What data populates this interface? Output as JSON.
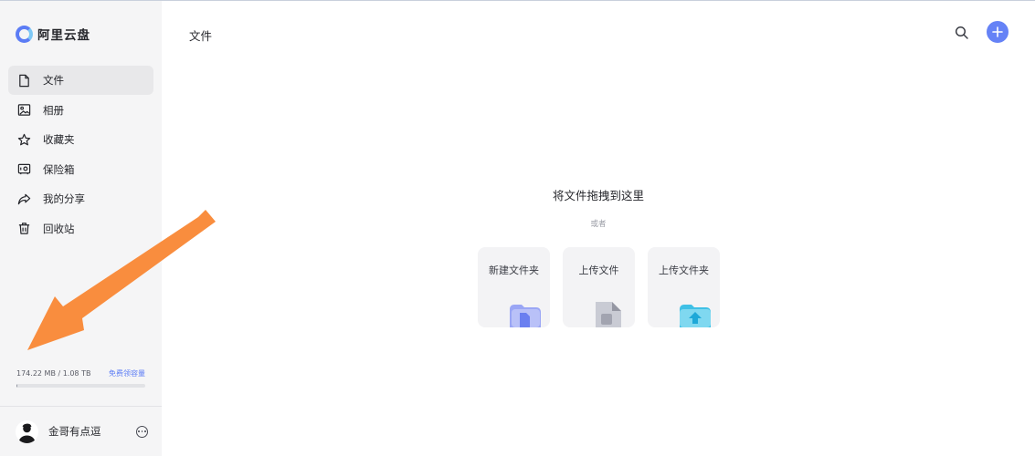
{
  "app": {
    "name": "阿里云盘"
  },
  "sidebar": {
    "items": [
      {
        "label": "文件",
        "icon": "file-icon",
        "active": true
      },
      {
        "label": "相册",
        "icon": "photo-icon",
        "active": false
      },
      {
        "label": "收藏夹",
        "icon": "star-icon",
        "active": false
      },
      {
        "label": "保险箱",
        "icon": "safe-icon",
        "active": false
      },
      {
        "label": "我的分享",
        "icon": "share-icon",
        "active": false
      },
      {
        "label": "回收站",
        "icon": "trash-icon",
        "active": false
      }
    ],
    "storage": {
      "used_text": "174.22 MB / 1.08 TB",
      "link": "免费领容量",
      "used_fraction": 0.0002
    }
  },
  "user": {
    "name": "金哥有点逗"
  },
  "header": {
    "title": "文件"
  },
  "dropzone": {
    "title": "将文件拖拽到这里",
    "or_text": "或者",
    "actions": [
      {
        "label": "新建文件夹",
        "icon": "new-folder-icon"
      },
      {
        "label": "上传文件",
        "icon": "upload-file-icon"
      },
      {
        "label": "上传文件夹",
        "icon": "upload-folder-icon"
      }
    ]
  },
  "colors": {
    "accent": "#6582f6",
    "sidebar_bg": "#f5f5f6",
    "annotation_arrow": "#f98d3e"
  }
}
